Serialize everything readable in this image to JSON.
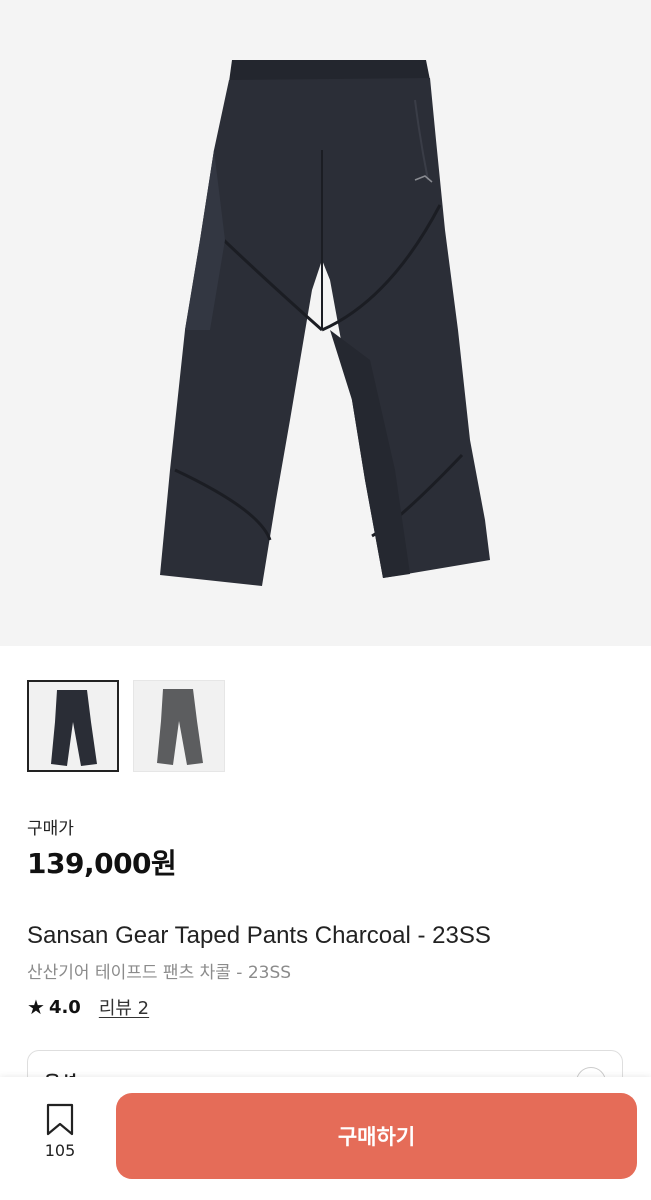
{
  "product": {
    "image_icon": "charcoal-pants-photo",
    "thumbnails": [
      {
        "name": "charcoal",
        "color": "#2a2d36",
        "selected": true
      },
      {
        "name": "grey",
        "color": "#5c5d5f",
        "selected": false
      }
    ],
    "price_label": "구매가",
    "price": "139,000원",
    "name_en": "Sansan Gear Taped Pants Charcoal - 23SS",
    "name_ko": "산산기어 테이프드 팬츠 차콜 - 23SS",
    "rating_star_icon": "star-icon",
    "rating": "4.0",
    "review_link": "리뷰 2"
  },
  "option": {
    "label": "옵션"
  },
  "bottom_bar": {
    "bookmark_icon": "bookmark-icon",
    "bookmark_count": "105",
    "buy_label": "구매하기",
    "buy_color": "#e56c58"
  }
}
